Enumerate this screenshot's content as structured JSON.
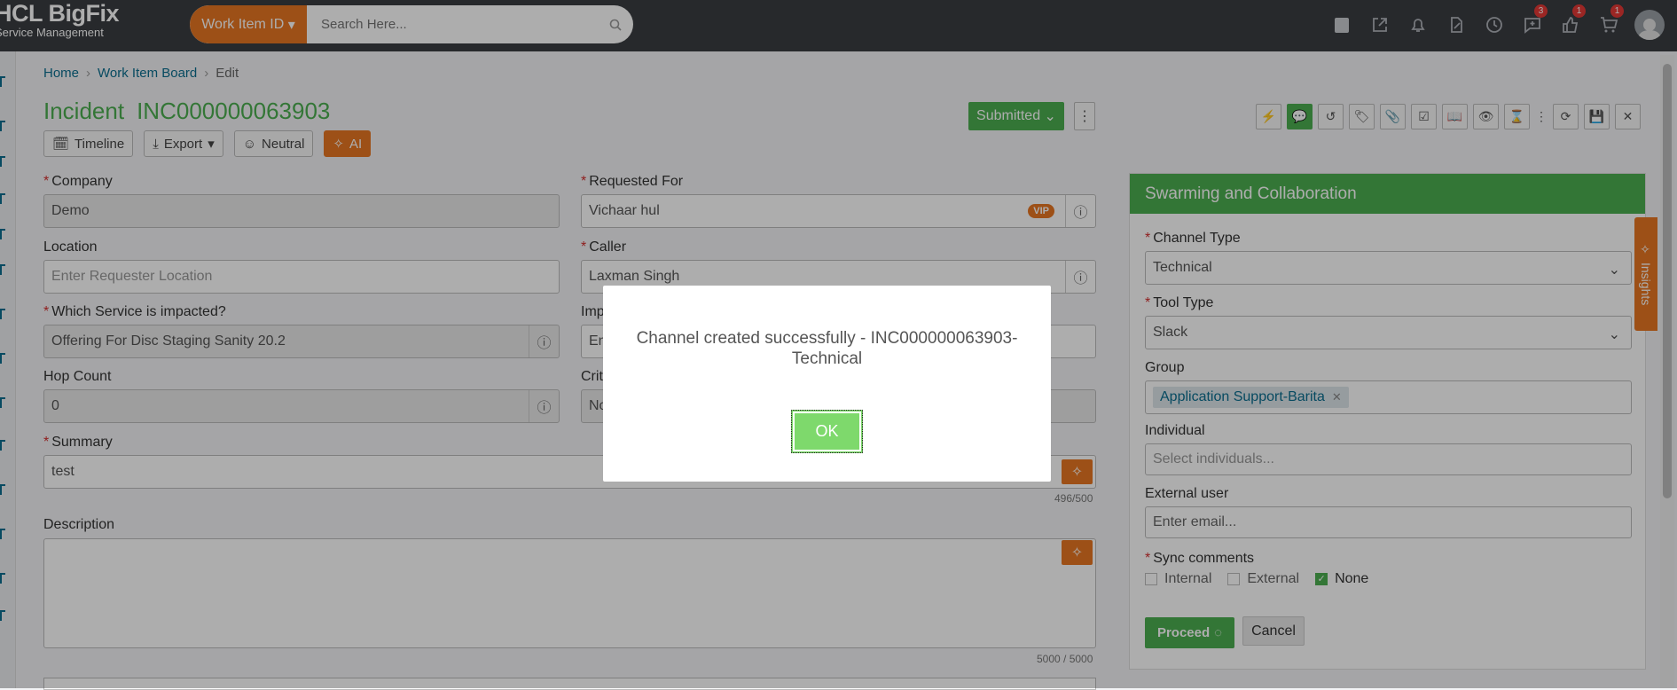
{
  "header": {
    "logo_line1": "HCL BigFix",
    "logo_line2": "Service Management",
    "search_dropdown": "Work Item ID",
    "search_placeholder": "Search Here...",
    "badges": {
      "chat": "3",
      "like": "1",
      "cart": "1"
    }
  },
  "breadcrumb": {
    "home": "Home",
    "board": "Work Item Board",
    "current": "Edit"
  },
  "incident": {
    "type": "Incident",
    "number": "INC000000063903"
  },
  "actions": {
    "timeline": "Timeline",
    "export": "Export",
    "sentiment": "Neutral",
    "ai": "AI",
    "status": "Submitted"
  },
  "form": {
    "company_label": "Company",
    "company_value": "Demo",
    "requested_for_label": "Requested For",
    "requested_for_value": "Vichaar hul",
    "vip": "VIP",
    "location_label": "Location",
    "location_placeholder": "Enter Requester Location",
    "caller_label": "Caller",
    "caller_value": "Laxman Singh",
    "service_label": "Which Service is impacted?",
    "service_value": "Offering For Disc Staging Sanity 20.2",
    "impact_label": "Imp",
    "impact_value": "En",
    "hop_label": "Hop Count",
    "hop_value": "0",
    "crit_label": "Crit",
    "crit_value": "No",
    "summary_label": "Summary",
    "summary_value": "test",
    "summary_counter": "496/500",
    "description_label": "Description",
    "description_counter": "5000 / 5000"
  },
  "swarm": {
    "title": "Swarming and Collaboration",
    "channel_type_label": "Channel Type",
    "channel_type_value": "Technical",
    "tool_type_label": "Tool Type",
    "tool_type_value": "Slack",
    "group_label": "Group",
    "group_chip": "Application Support-Barita",
    "individual_label": "Individual",
    "individual_placeholder": "Select individuals...",
    "external_label": "External user",
    "external_placeholder": "Enter email...",
    "sync_label": "Sync comments",
    "sync_internal": "Internal",
    "sync_external": "External",
    "sync_none": "None",
    "proceed": "Proceed",
    "cancel": "Cancel"
  },
  "insights": "Insights",
  "modal": {
    "message": "Channel created successfully - INC000000063903-Technical",
    "ok": "OK"
  },
  "colors": {
    "accent_green": "#4caf50",
    "accent_orange": "#e87722",
    "link_teal": "#0b6e8f",
    "topbar": "#3a3d42"
  }
}
